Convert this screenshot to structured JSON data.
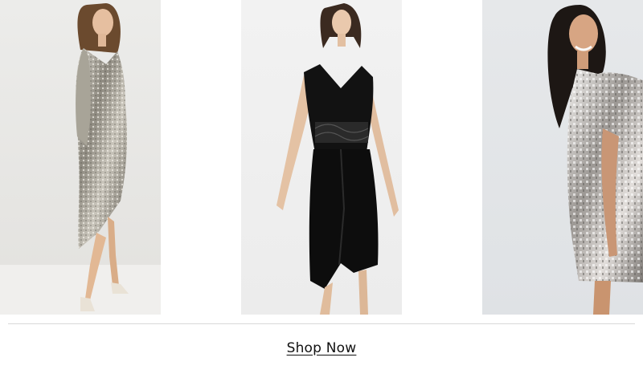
{
  "products": [
    {
      "image": "product-image-silver-sequin-wrap-midi-dress"
    },
    {
      "image": "product-image-black-velvet-lace-midi-dress"
    },
    {
      "image": "product-image-silver-sequin-tshirt-dress"
    }
  ],
  "cta": {
    "label": "Shop Now"
  },
  "colors": {
    "text": "#111111",
    "divider": "#d9d9d9",
    "background": "#ffffff"
  }
}
